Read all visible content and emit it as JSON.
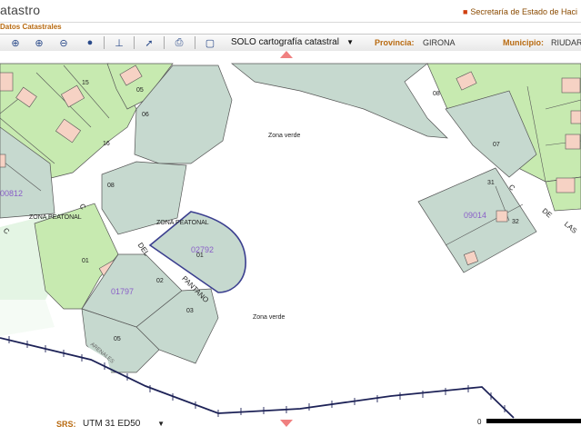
{
  "header": {
    "app_title": "atastro",
    "secretaria": "Secretaría de Estado de Haci"
  },
  "subbar": {
    "tab_label": "Datos Catastrales"
  },
  "toolbar": {
    "layer_select": "SOLO cartografía catastral",
    "provincia_label": "Provincia:",
    "provincia_value": "GIRONA",
    "municipio_label": "Municipio:",
    "municipio_value": "RIUDAR"
  },
  "footer": {
    "srs_label": "SRS:",
    "srs_value": "UTM 31 ED50",
    "scale_zero": "0"
  },
  "map": {
    "labels": {
      "zona_verde_1": "Zona verde",
      "zona_verde_2": "Zona verde",
      "zona_peatonal_1": "ZONA PEATONAL",
      "zona_peatonal_2": "ZONA PEATONAL",
      "street_c": "C",
      "street_del": "DEL",
      "street_pantano": "PANTANO",
      "street_c_right": "C",
      "street_de": "DE",
      "street_las": "LAS",
      "street_bottom": "ARENALES"
    },
    "parcel_ids": {
      "p1": "02792",
      "p2": "01797",
      "p3": "00812",
      "p4": "09014"
    },
    "lot_numbers": [
      "15",
      "16",
      "05",
      "06",
      "08",
      "01",
      "02",
      "03",
      "05",
      "01",
      "08",
      "07",
      "31",
      "32"
    ],
    "colors": {
      "green_parcel": "#c7eab0",
      "grey_parcel": "#c6d9cf",
      "parcel_id": "#8a5fc8",
      "selected_border": "#3b3f8f",
      "building": "#f6d2c4"
    }
  }
}
